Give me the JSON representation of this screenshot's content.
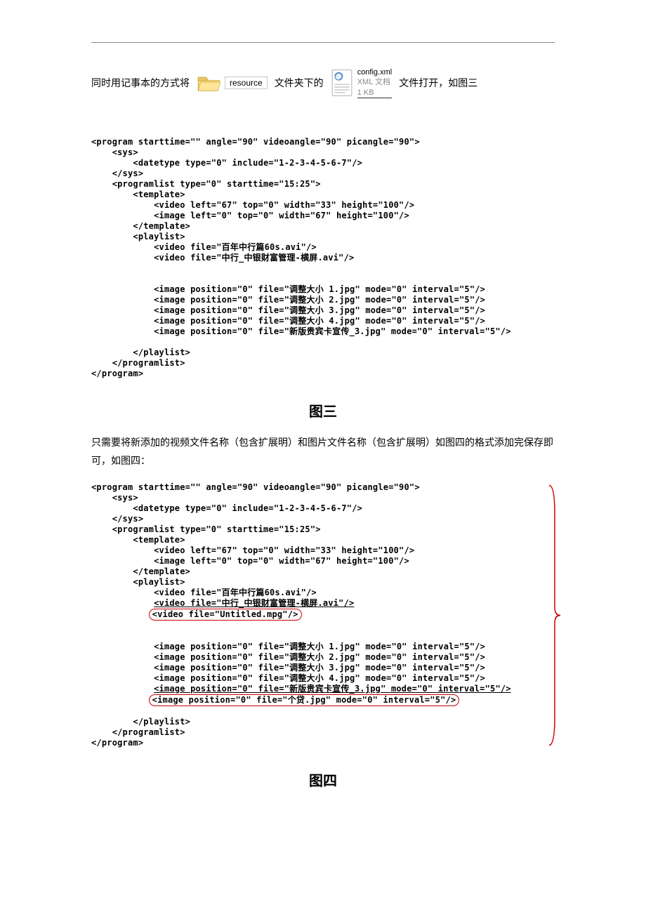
{
  "intro": {
    "part1": "同时用记事本的方式将",
    "folder_label": "resource",
    "part2": "文件夹下的",
    "file_name": "config.xml",
    "file_type": "XML 文档",
    "file_size": "1 KB",
    "part3": "文件打开，如图三"
  },
  "code1": "<program starttime=\"\" angle=\"90\" videoangle=\"90\" picangle=\"90\">\n    <sys>\n        <datetype type=\"0\" include=\"1-2-3-4-5-6-7\"/>\n    </sys>\n    <programlist type=\"0\" starttime=\"15:25\">\n        <template>\n            <video left=\"67\" top=\"0\" width=\"33\" height=\"100\"/>\n            <image left=\"0\" top=\"0\" width=\"67\" height=\"100\"/>\n        </template>\n        <playlist>\n            <video file=\"百年中行篇60s.avi\"/>\n            <video file=\"中行_中银财富管理-横屏.avi\"/>\n\n\n            <image position=\"0\" file=\"调整大小 1.jpg\" mode=\"0\" interval=\"5\"/>\n            <image position=\"0\" file=\"调整大小 2.jpg\" mode=\"0\" interval=\"5\"/>\n            <image position=\"0\" file=\"调整大小 3.jpg\" mode=\"0\" interval=\"5\"/>\n            <image position=\"0\" file=\"调整大小 4.jpg\" mode=\"0\" interval=\"5\"/>\n            <image position=\"0\" file=\"新版贵宾卡宣传_3.jpg\" mode=\"0\" interval=\"5\"/>\n\n        </playlist>\n    </programlist>\n</program>",
  "caption1": "图三",
  "para1": "只需要将新添加的视频文件名称（包含扩展明）和图片文件名称（包含扩展明）如图四的格式添加完保存即可，如图四：",
  "code2": {
    "l1": "<program starttime=\"\" angle=\"90\" videoangle=\"90\" picangle=\"90\">",
    "l2": "    <sys>",
    "l3": "        <datetype type=\"0\" include=\"1-2-3-4-5-6-7\"/>",
    "l4": "    </sys>",
    "l5": "    <programlist type=\"0\" starttime=\"15:25\">",
    "l6": "        <template>",
    "l7": "            <video left=\"67\" top=\"0\" width=\"33\" height=\"100\"/>",
    "l8": "            <image left=\"0\" top=\"0\" width=\"67\" height=\"100\"/>",
    "l9": "        </template>",
    "l10": "        <playlist>",
    "l11": "            <video file=\"百年中行篇60s.avi\"/>",
    "l12a": "            ",
    "l12b": "<video file=\"中行_中银财富管理-横屏.avi\"/>",
    "l13a": "           ",
    "l13b": "<video file=\"Untitled.mpg\"/>",
    "blank": "",
    "l14": "            <image position=\"0\" file=\"调整大小 1.jpg\" mode=\"0\" interval=\"5\"/>",
    "l15": "            <image position=\"0\" file=\"调整大小 2.jpg\" mode=\"0\" interval=\"5\"/>",
    "l16": "            <image position=\"0\" file=\"调整大小 3.jpg\" mode=\"0\" interval=\"5\"/>",
    "l17": "            <image position=\"0\" file=\"调整大小 4.jpg\" mode=\"0\" interval=\"5\"/>",
    "l18a": "            ",
    "l18b": "<image position=\"0\" file=\"新版贵宾卡宣传_3.jpg\" mode=\"0\" interval=\"5\"/>",
    "l19a": "           ",
    "l19b": "<image position=\"0\" file=\"个贷.jpg\" mode=\"0\" interval=\"5\"/>",
    "l20": "        </playlist>",
    "l21": "    </programlist>",
    "l22": "</program>"
  },
  "caption2": "图四"
}
